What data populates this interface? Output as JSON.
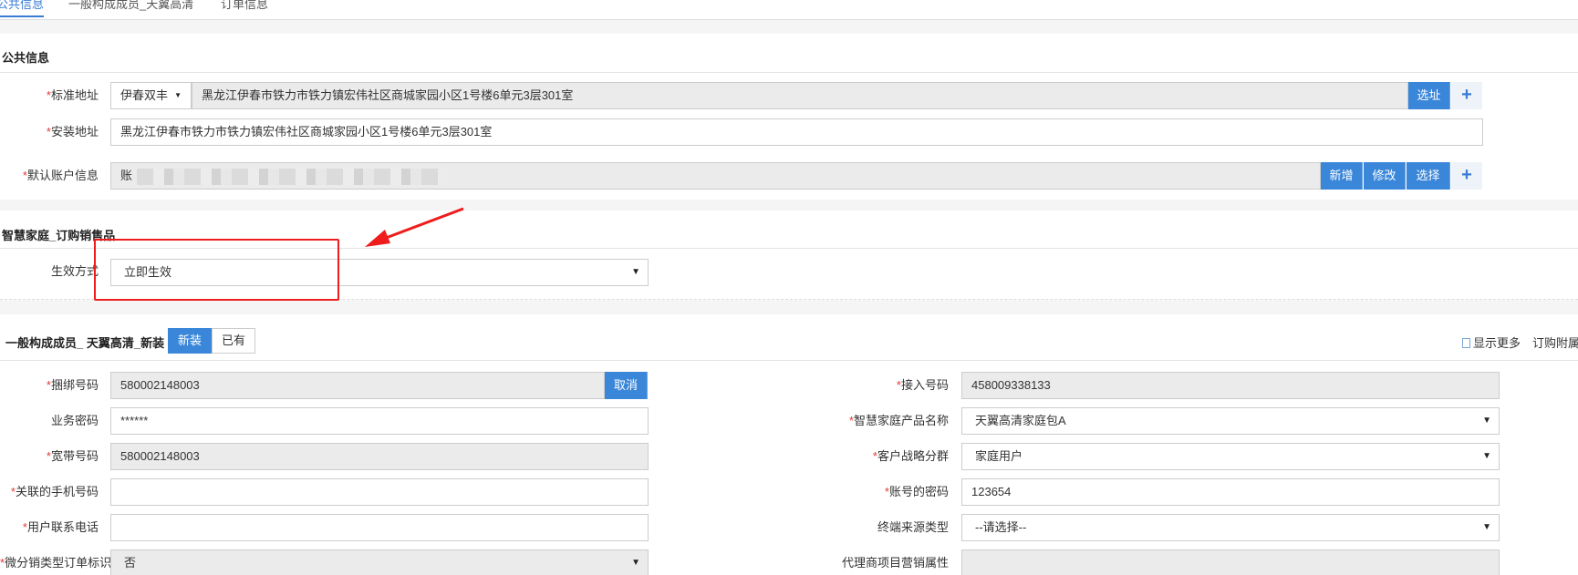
{
  "tabs": [
    {
      "label": "公共信息"
    },
    {
      "label": "一般构成成员_天翼高清"
    },
    {
      "label": "订单信息"
    }
  ],
  "public": {
    "title": "公共信息",
    "std_addr_label": "标准地址",
    "std_addr_region": "伊春双丰",
    "std_addr_value": "黑龙江伊春市铁力市铁力镇宏伟社区商城家园小区1号楼6单元3层301室",
    "select_addr_btn": "选址",
    "install_addr_label": "安装地址",
    "install_addr_value": "黑龙江伊春市铁力市铁力镇宏伟社区商城家园小区1号楼6单元3层301室",
    "account_label": "默认账户信息",
    "account_prefix": "账",
    "add_btn": "新增",
    "edit_btn": "修改",
    "choose_btn": "选择",
    "plus": "+"
  },
  "smart": {
    "title": "智慧家庭_订购销售品",
    "effect_label": "生效方式",
    "effect_value": "立即生效"
  },
  "member": {
    "title": "一般构成成员_ 天翼高清_新装",
    "seg_new": "新装",
    "seg_exist": "已有",
    "show_more": "显示更多",
    "order_attach": "订购附属",
    "fields_left": [
      {
        "label": "捆绑号码",
        "required": true,
        "value": "580002148003"
      },
      {
        "label": "业务密码",
        "required": false,
        "value": "******"
      },
      {
        "label": "宽带号码",
        "required": true,
        "value": "580002148003"
      },
      {
        "label": "关联的手机号码",
        "required": true,
        "value": ""
      },
      {
        "label": "用户联系电话",
        "required": true,
        "value": ""
      },
      {
        "label": "微分销类型订单标识",
        "required": true,
        "value": "否"
      }
    ],
    "cancel_btn": "取消",
    "fields_right": [
      {
        "label": "接入号码",
        "required": true,
        "value": "458009338133"
      },
      {
        "label": "智慧家庭产品名称",
        "required": true,
        "value": "天翼高清家庭包A"
      },
      {
        "label": "客户战略分群",
        "required": true,
        "value": "家庭用户"
      },
      {
        "label": "账号的密码",
        "required": true,
        "value": "123654"
      },
      {
        "label": "终端来源类型",
        "required": false,
        "value": "--请选择--"
      },
      {
        "label": "代理商项目营销属性",
        "required": false,
        "value": ""
      }
    ],
    "required_mark": "*",
    "caret": "▼"
  },
  "colors": {
    "accent": "#3a86d9",
    "annotation": "#ee1c1c",
    "required": "#e53935"
  }
}
